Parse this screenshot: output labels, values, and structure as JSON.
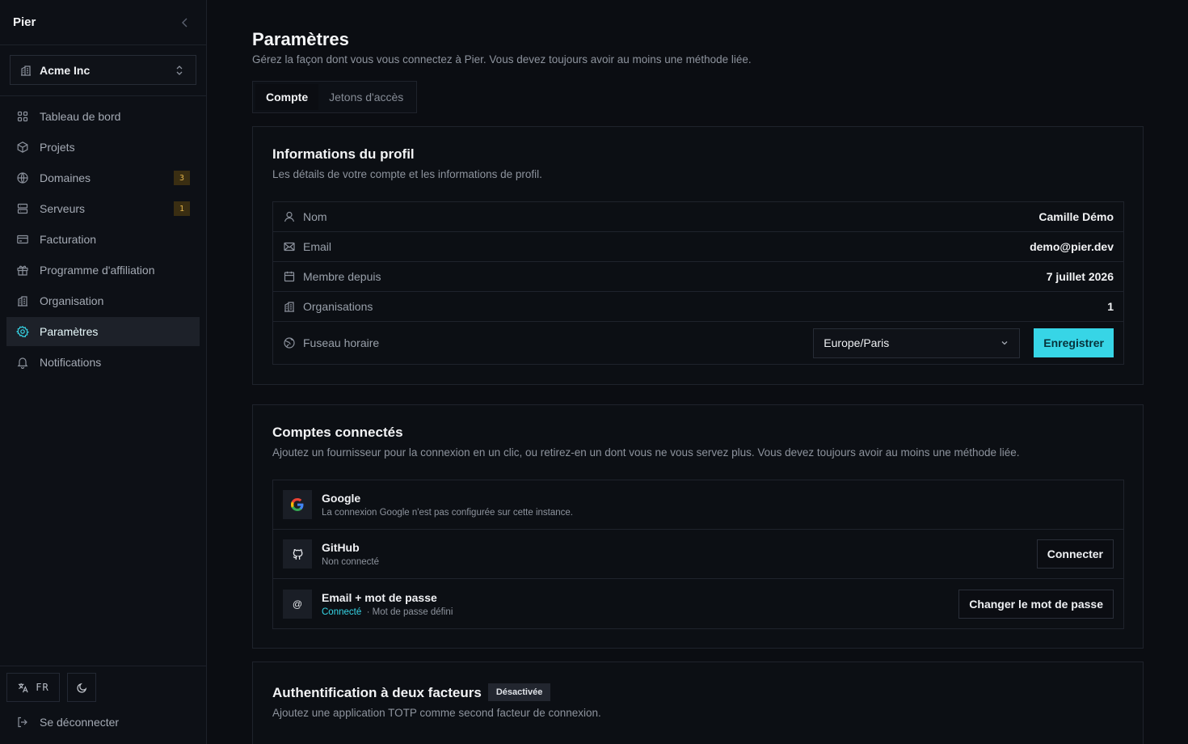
{
  "sidebar": {
    "brand": "Pier",
    "org_name": "Acme Inc",
    "items": [
      {
        "label": "Tableau de bord",
        "icon": "dashboard-icon"
      },
      {
        "label": "Projets",
        "icon": "box-icon"
      },
      {
        "label": "Domaines",
        "icon": "globe-icon",
        "badge": "3"
      },
      {
        "label": "Serveurs",
        "icon": "server-icon",
        "badge": "1"
      },
      {
        "label": "Facturation",
        "icon": "credit-card-icon"
      },
      {
        "label": "Programme d'affiliation",
        "icon": "gift-icon"
      },
      {
        "label": "Organisation",
        "icon": "building-icon"
      },
      {
        "label": "Paramètres",
        "icon": "settings-icon",
        "active": true
      },
      {
        "label": "Notifications",
        "icon": "bell-icon"
      }
    ],
    "language": "FR",
    "logout_label": "Se déconnecter"
  },
  "page": {
    "title": "Paramètres",
    "subtitle": "Gérez la façon dont vous vous connectez à Pier. Vous devez toujours avoir au moins une méthode liée.",
    "tabs": [
      {
        "label": "Compte",
        "active": true
      },
      {
        "label": "Jetons d'accès"
      }
    ]
  },
  "profile": {
    "title": "Informations du profil",
    "subtitle": "Les détails de votre compte et les informations de profil.",
    "rows": [
      {
        "label": "Nom",
        "value": "Camille Démo",
        "icon": "user-icon"
      },
      {
        "label": "Email",
        "value": "demo@pier.dev",
        "icon": "mail-icon"
      },
      {
        "label": "Membre depuis",
        "value": "7 juillet 2026",
        "icon": "calendar-icon"
      },
      {
        "label": "Organisations",
        "value": "1",
        "icon": "building-icon"
      }
    ],
    "timezone_label": "Fuseau horaire",
    "timezone_value": "Europe/Paris",
    "save_label": "Enregistrer"
  },
  "connected": {
    "title": "Comptes connectés",
    "subtitle": "Ajoutez un fournisseur pour la connexion en un clic, ou retirez-en un dont vous ne vous servez plus. Vous devez toujours avoir au moins une méthode liée.",
    "providers": [
      {
        "name": "Google",
        "status": "La connexion Google n'est pas configurée sur cette instance.",
        "icon": "google-icon"
      },
      {
        "name": "GitHub",
        "status": "Non connecté",
        "action": "Connecter",
        "icon": "github-icon"
      },
      {
        "name": "Email + mot de passe",
        "status_ok": "Connecté",
        "status_extra": "· Mot de passe défini",
        "action": "Changer le mot de passe",
        "icon": "at-icon",
        "icon_glyph": "@"
      }
    ]
  },
  "twofa": {
    "title": "Authentification à deux facteurs",
    "status": "Désactivée",
    "subtitle": "Ajoutez une application TOTP comme second facteur de connexion."
  }
}
